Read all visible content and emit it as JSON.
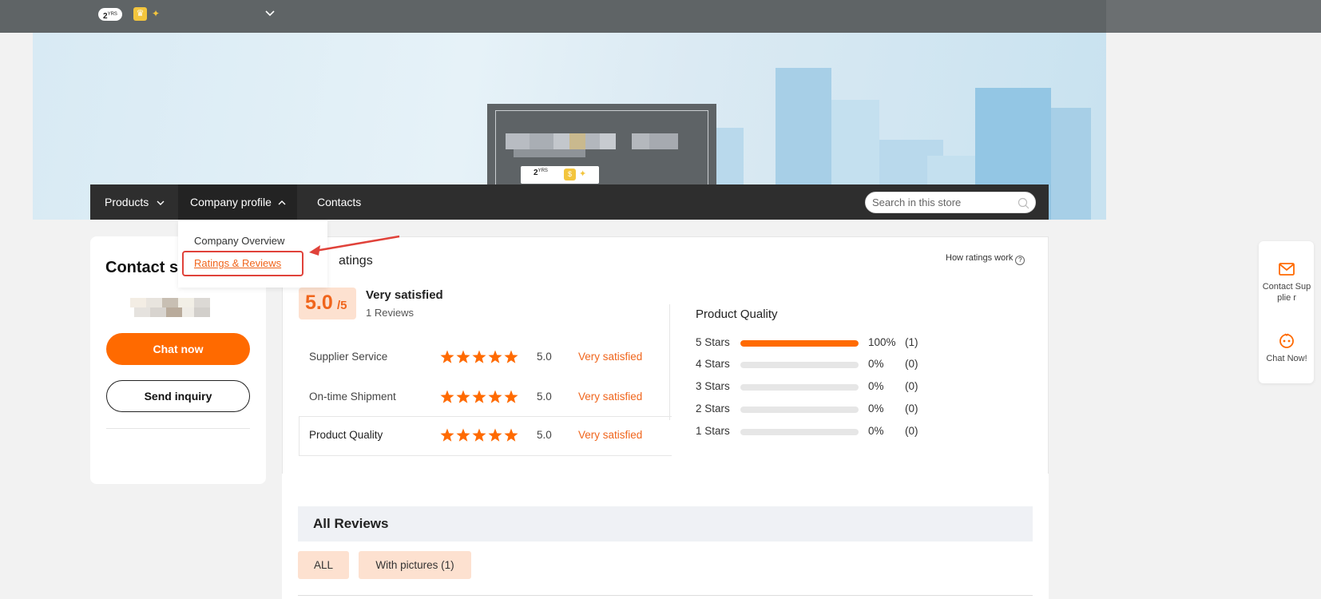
{
  "topbar": {
    "years_number": "2",
    "years_suffix": "YRS"
  },
  "store_logo": {
    "years_number": "2",
    "years_suffix": "YRS"
  },
  "nav": {
    "items": [
      {
        "label": "Products"
      },
      {
        "label": "Company profile"
      },
      {
        "label": "Contacts"
      }
    ],
    "search_placeholder": "Search in this store"
  },
  "dropdown": {
    "items": [
      {
        "label": "Company Overview"
      },
      {
        "label": "Ratings & Reviews"
      }
    ]
  },
  "contact": {
    "title": "Contact s",
    "chat_label": "Chat now",
    "inquiry_label": "Send inquiry"
  },
  "ratings": {
    "title_fragment": "atings",
    "how_label": "How ratings work",
    "score": "5.0",
    "score_max": "/5",
    "overall_label": "Very satisfied",
    "review_count": "1 Reviews",
    "rows": [
      {
        "label": "Supplier Service",
        "stars": 5,
        "score": "5.0",
        "status": "Very satisfied"
      },
      {
        "label": "On-time Shipment",
        "stars": 5,
        "score": "5.0",
        "status": "Very satisfied"
      },
      {
        "label": "Product Quality",
        "stars": 5,
        "score": "5.0",
        "status": "Very satisfied"
      }
    ]
  },
  "product_quality": {
    "title": "Product Quality",
    "distribution": [
      {
        "label": "5 Stars",
        "pct": "100%",
        "count": "(1)",
        "fraction": 1.0
      },
      {
        "label": "4 Stars",
        "pct": "0%",
        "count": "(0)",
        "fraction": 0
      },
      {
        "label": "3 Stars",
        "pct": "0%",
        "count": "(0)",
        "fraction": 0
      },
      {
        "label": "2 Stars",
        "pct": "0%",
        "count": "(0)",
        "fraction": 0
      },
      {
        "label": "1 Stars",
        "pct": "0%",
        "count": "(0)",
        "fraction": 0
      }
    ]
  },
  "reviews": {
    "title": "All Reviews",
    "filters": [
      {
        "label": "ALL"
      },
      {
        "label": "With pictures (1)"
      }
    ]
  },
  "float_panel": {
    "contact_label": "Contact Supplie r",
    "chat_label": "Chat Now!"
  },
  "colors": {
    "accent": "#ff6a00",
    "accent_text": "#f0651c",
    "nav_bg": "#2e2e2e",
    "annotation": "#e0423a"
  },
  "icons": [
    "chevron-down-icon",
    "chevron-up-icon",
    "search-icon",
    "star-icon",
    "question-icon",
    "mail-icon",
    "chat-bot-icon",
    "crown-icon",
    "handshake-icon"
  ]
}
